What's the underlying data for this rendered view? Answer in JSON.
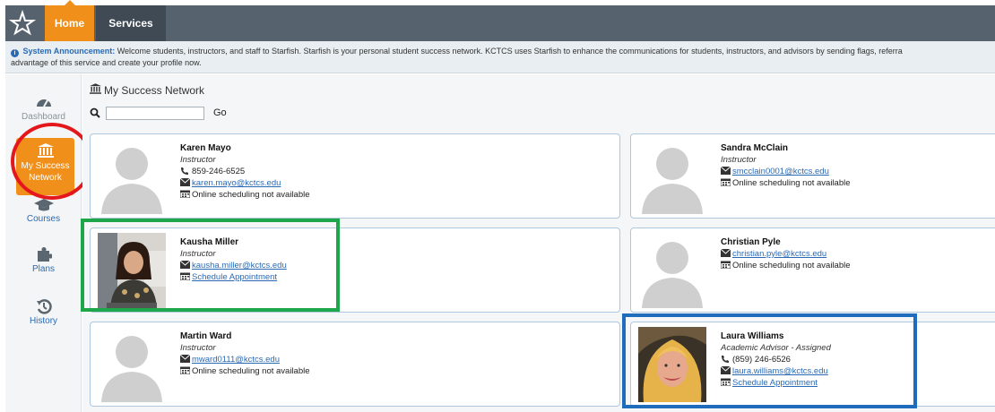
{
  "nav": {
    "logo_icon": "starfish-logo-icon",
    "tabs": [
      {
        "label": "Home",
        "active": true
      },
      {
        "label": "Services",
        "active": false
      }
    ]
  },
  "announcement": {
    "label": "System Announcement:",
    "text": "Welcome students, instructors, and staff to Starfish. Starfish is your personal student success network. KCTCS uses Starfish to enhance the communications for students, instructors, and advisors by sending flags, referra",
    "text_line2": "advantage of this service and create your profile now."
  },
  "sidebar": {
    "items": [
      {
        "label": "Dashboard",
        "icon": "dashboard-icon"
      },
      {
        "label": "My Success Network",
        "icon": "bank-icon",
        "active": true
      },
      {
        "label": "Courses",
        "icon": "graduation-cap-icon"
      },
      {
        "label": "Plans",
        "icon": "puzzle-icon"
      },
      {
        "label": "History",
        "icon": "history-icon"
      }
    ]
  },
  "main": {
    "title": "My Success Network",
    "search": {
      "value": "",
      "placeholder": "",
      "go_label": "Go"
    }
  },
  "contacts": [
    {
      "name": "Karen Mayo",
      "role": "Instructor",
      "phone": "859-246-6525",
      "email": "karen.mayo@kctcs.edu",
      "schedule": "Online scheduling not available",
      "schedule_link": false,
      "photo": false
    },
    {
      "name": "Sandra McClain",
      "role": "Instructor",
      "phone": "",
      "email": "smcclain0001@kctcs.edu",
      "schedule": "Online scheduling not available",
      "schedule_link": false,
      "photo": false
    },
    {
      "name": "Kausha Miller",
      "role": "Instructor",
      "phone": "",
      "email": "kausha.miller@kctcs.edu",
      "schedule": "Schedule Appointment",
      "schedule_link": true,
      "photo": true
    },
    {
      "name": "Christian Pyle",
      "role": "",
      "phone": "",
      "email": "christian.pyle@kctcs.edu",
      "schedule": "Online scheduling not available",
      "schedule_link": false,
      "photo": false
    },
    {
      "name": "Martin Ward",
      "role": "Instructor",
      "phone": "",
      "email": "mward0111@kctcs.edu",
      "schedule": "Online scheduling not available",
      "schedule_link": false,
      "photo": false
    },
    {
      "name": "Laura Williams",
      "role": "Academic Advisor - Assigned",
      "phone": "(859) 246-6526",
      "email": "laura.williams@kctcs.edu",
      "schedule": "Schedule Appointment",
      "schedule_link": true,
      "photo": true
    }
  ],
  "colors": {
    "accent": "#f0901a",
    "nav_bg": "#56636f",
    "link": "#2a6ab5",
    "highlight_red": "#e4181c",
    "highlight_green": "#1ea64a",
    "highlight_blue": "#1f6cbd"
  }
}
